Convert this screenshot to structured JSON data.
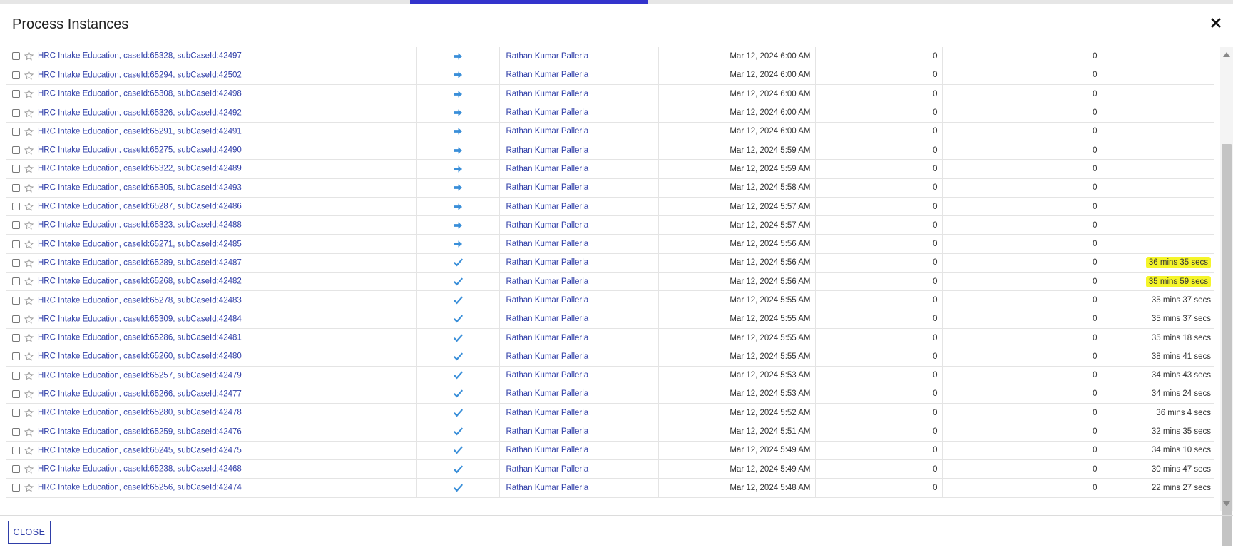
{
  "dialog": {
    "title": "Process Instances",
    "close_button_label": "CLOSE"
  },
  "colors": {
    "link": "#2f3ea8",
    "status_icon": "#3a8fd9",
    "highlight": "#f5f52a",
    "active_tab": "#3333cc"
  },
  "icons": {
    "close": "close-icon",
    "star": "star-icon",
    "forward": "forward-arrow-icon",
    "completed": "checkmark-icon"
  },
  "rows": [
    {
      "name": "HRC Intake Education, caseId:65328, subCaseId:42497",
      "status": "forward",
      "user": "Rathan Kumar Pallerla",
      "date": "Mar 12, 2024 6:00 AM",
      "n1": "0",
      "n2": "0",
      "duration": "",
      "highlight": false
    },
    {
      "name": "HRC Intake Education, caseId:65294, subCaseId:42502",
      "status": "forward",
      "user": "Rathan Kumar Pallerla",
      "date": "Mar 12, 2024 6:00 AM",
      "n1": "0",
      "n2": "0",
      "duration": "",
      "highlight": false
    },
    {
      "name": "HRC Intake Education, caseId:65308, subCaseId:42498",
      "status": "forward",
      "user": "Rathan Kumar Pallerla",
      "date": "Mar 12, 2024 6:00 AM",
      "n1": "0",
      "n2": "0",
      "duration": "",
      "highlight": false
    },
    {
      "name": "HRC Intake Education, caseId:65326, subCaseId:42492",
      "status": "forward",
      "user": "Rathan Kumar Pallerla",
      "date": "Mar 12, 2024 6:00 AM",
      "n1": "0",
      "n2": "0",
      "duration": "",
      "highlight": false
    },
    {
      "name": "HRC Intake Education, caseId:65291, subCaseId:42491",
      "status": "forward",
      "user": "Rathan Kumar Pallerla",
      "date": "Mar 12, 2024 6:00 AM",
      "n1": "0",
      "n2": "0",
      "duration": "",
      "highlight": false
    },
    {
      "name": "HRC Intake Education, caseId:65275, subCaseId:42490",
      "status": "forward",
      "user": "Rathan Kumar Pallerla",
      "date": "Mar 12, 2024 5:59 AM",
      "n1": "0",
      "n2": "0",
      "duration": "",
      "highlight": false
    },
    {
      "name": "HRC Intake Education, caseId:65322, subCaseId:42489",
      "status": "forward",
      "user": "Rathan Kumar Pallerla",
      "date": "Mar 12, 2024 5:59 AM",
      "n1": "0",
      "n2": "0",
      "duration": "",
      "highlight": false
    },
    {
      "name": "HRC Intake Education, caseId:65305, subCaseId:42493",
      "status": "forward",
      "user": "Rathan Kumar Pallerla",
      "date": "Mar 12, 2024 5:58 AM",
      "n1": "0",
      "n2": "0",
      "duration": "",
      "highlight": false
    },
    {
      "name": "HRC Intake Education, caseId:65287, subCaseId:42486",
      "status": "forward",
      "user": "Rathan Kumar Pallerla",
      "date": "Mar 12, 2024 5:57 AM",
      "n1": "0",
      "n2": "0",
      "duration": "",
      "highlight": false
    },
    {
      "name": "HRC Intake Education, caseId:65323, subCaseId:42488",
      "status": "forward",
      "user": "Rathan Kumar Pallerla",
      "date": "Mar 12, 2024 5:57 AM",
      "n1": "0",
      "n2": "0",
      "duration": "",
      "highlight": false
    },
    {
      "name": "HRC Intake Education, caseId:65271, subCaseId:42485",
      "status": "forward",
      "user": "Rathan Kumar Pallerla",
      "date": "Mar 12, 2024 5:56 AM",
      "n1": "0",
      "n2": "0",
      "duration": "",
      "highlight": false
    },
    {
      "name": "HRC Intake Education, caseId:65289, subCaseId:42487",
      "status": "completed",
      "user": "Rathan Kumar Pallerla",
      "date": "Mar 12, 2024 5:56 AM",
      "n1": "0",
      "n2": "0",
      "duration": "36 mins 35 secs",
      "highlight": true
    },
    {
      "name": "HRC Intake Education, caseId:65268, subCaseId:42482",
      "status": "completed",
      "user": "Rathan Kumar Pallerla",
      "date": "Mar 12, 2024 5:56 AM",
      "n1": "0",
      "n2": "0",
      "duration": "35 mins 59 secs",
      "highlight": true
    },
    {
      "name": "HRC Intake Education, caseId:65278, subCaseId:42483",
      "status": "completed",
      "user": "Rathan Kumar Pallerla",
      "date": "Mar 12, 2024 5:55 AM",
      "n1": "0",
      "n2": "0",
      "duration": "35 mins 37 secs",
      "highlight": false
    },
    {
      "name": "HRC Intake Education, caseId:65309, subCaseId:42484",
      "status": "completed",
      "user": "Rathan Kumar Pallerla",
      "date": "Mar 12, 2024 5:55 AM",
      "n1": "0",
      "n2": "0",
      "duration": "35 mins 37 secs",
      "highlight": false
    },
    {
      "name": "HRC Intake Education, caseId:65286, subCaseId:42481",
      "status": "completed",
      "user": "Rathan Kumar Pallerla",
      "date": "Mar 12, 2024 5:55 AM",
      "n1": "0",
      "n2": "0",
      "duration": "35 mins 18 secs",
      "highlight": false
    },
    {
      "name": "HRC Intake Education, caseId:65260, subCaseId:42480",
      "status": "completed",
      "user": "Rathan Kumar Pallerla",
      "date": "Mar 12, 2024 5:55 AM",
      "n1": "0",
      "n2": "0",
      "duration": "38 mins 41 secs",
      "highlight": false
    },
    {
      "name": "HRC Intake Education, caseId:65257, subCaseId:42479",
      "status": "completed",
      "user": "Rathan Kumar Pallerla",
      "date": "Mar 12, 2024 5:53 AM",
      "n1": "0",
      "n2": "0",
      "duration": "34 mins 43 secs",
      "highlight": false
    },
    {
      "name": "HRC Intake Education, caseId:65266, subCaseId:42477",
      "status": "completed",
      "user": "Rathan Kumar Pallerla",
      "date": "Mar 12, 2024 5:53 AM",
      "n1": "0",
      "n2": "0",
      "duration": "34 mins 24 secs",
      "highlight": false
    },
    {
      "name": "HRC Intake Education, caseId:65280, subCaseId:42478",
      "status": "completed",
      "user": "Rathan Kumar Pallerla",
      "date": "Mar 12, 2024 5:52 AM",
      "n1": "0",
      "n2": "0",
      "duration": "36 mins 4 secs",
      "highlight": false
    },
    {
      "name": "HRC Intake Education, caseId:65259, subCaseId:42476",
      "status": "completed",
      "user": "Rathan Kumar Pallerla",
      "date": "Mar 12, 2024 5:51 AM",
      "n1": "0",
      "n2": "0",
      "duration": "32 mins 35 secs",
      "highlight": false
    },
    {
      "name": "HRC Intake Education, caseId:65245, subCaseId:42475",
      "status": "completed",
      "user": "Rathan Kumar Pallerla",
      "date": "Mar 12, 2024 5:49 AM",
      "n1": "0",
      "n2": "0",
      "duration": "34 mins 10 secs",
      "highlight": false
    },
    {
      "name": "HRC Intake Education, caseId:65238, subCaseId:42468",
      "status": "completed",
      "user": "Rathan Kumar Pallerla",
      "date": "Mar 12, 2024 5:49 AM",
      "n1": "0",
      "n2": "0",
      "duration": "30 mins 47 secs",
      "highlight": false
    },
    {
      "name": "HRC Intake Education, caseId:65256, subCaseId:42474",
      "status": "completed",
      "user": "Rathan Kumar Pallerla",
      "date": "Mar 12, 2024 5:48 AM",
      "n1": "0",
      "n2": "0",
      "duration": "22 mins 27 secs",
      "highlight": false
    }
  ]
}
